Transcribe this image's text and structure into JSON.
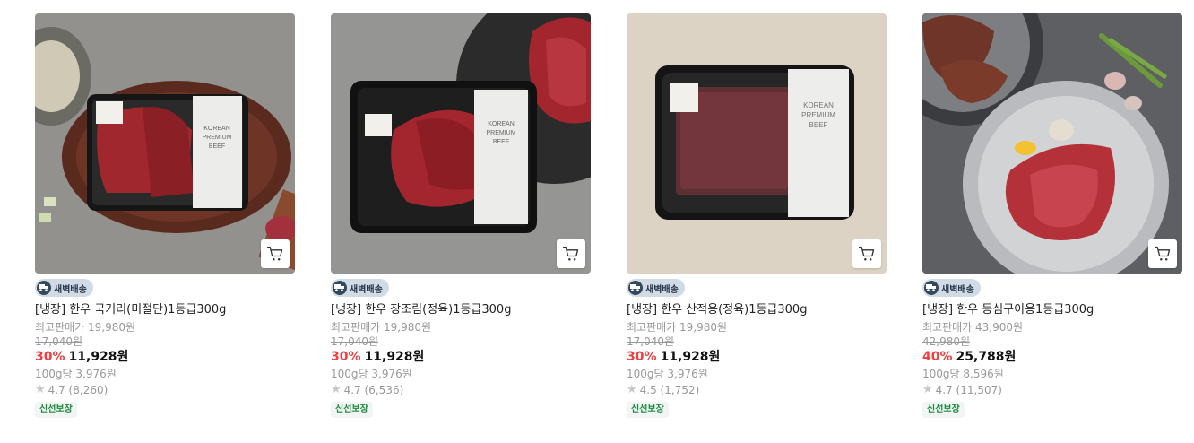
{
  "products": [
    {
      "delivery_badge": "새벽배송",
      "name": "[냉장] 한우 국거리(미절단)1등급300g",
      "max_price": "최고판매가 19,980원",
      "original_price": "17,040원",
      "discount": "30%",
      "price": "11,928원",
      "unit_price": "100g당 3,976원",
      "rating": "4.7 (8,260)",
      "fresh_badge": "신선보장"
    },
    {
      "delivery_badge": "새벽배송",
      "name": "[냉장] 한우 장조림(정육)1등급300g",
      "max_price": "최고판매가 19,980원",
      "original_price": "17,040원",
      "discount": "30%",
      "price": "11,928원",
      "unit_price": "100g당 3,976원",
      "rating": "4.7 (6,536)",
      "fresh_badge": "신선보장"
    },
    {
      "delivery_badge": "새벽배송",
      "name": "[냉장] 한우 산적용(정육)1등급300g",
      "max_price": "최고판매가 19,980원",
      "original_price": "17,040원",
      "discount": "30%",
      "price": "11,928원",
      "unit_price": "100g당 3,976원",
      "rating": "4.5 (1,752)",
      "fresh_badge": "신선보장"
    },
    {
      "delivery_badge": "새벽배송",
      "name": "[냉장] 한우 등심구이용1등급300g",
      "max_price": "최고판매가 43,900원",
      "original_price": "42,980원",
      "discount": "40%",
      "price": "25,788원",
      "unit_price": "100g당 8,596원",
      "rating": "4.7 (11,507)",
      "fresh_badge": "신선보장"
    }
  ],
  "package_label": [
    "KOREAN",
    "PREMIUM",
    "BEEF"
  ],
  "colors": {
    "discount": "#f03f40",
    "fresh": "#1a8a3f",
    "badge_bg": "#d0dbe6"
  },
  "icons": {
    "cart": "cart-icon",
    "truck": "truck-icon",
    "star": "star-icon"
  }
}
